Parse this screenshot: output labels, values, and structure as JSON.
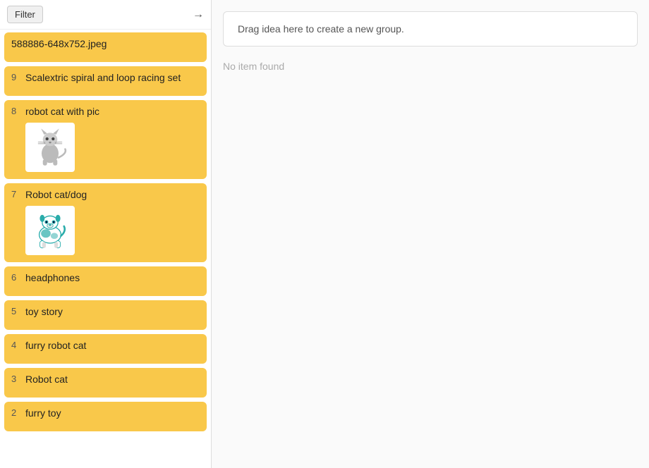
{
  "header": {
    "filter_label": "Filter",
    "arrow_icon": "→"
  },
  "drop_zone": {
    "text": "Drag idea here to create a new group."
  },
  "no_item_text": "No item found",
  "items": [
    {
      "id": "item-file",
      "number": "",
      "title": "588886-648x752.jpeg",
      "has_image": false,
      "image_type": null
    },
    {
      "id": "item-9",
      "number": "9",
      "title": "Scalextric spiral and loop racing set",
      "has_image": false,
      "image_type": null
    },
    {
      "id": "item-8",
      "number": "8",
      "title": "robot cat with pic",
      "has_image": true,
      "image_type": "robot-cat"
    },
    {
      "id": "item-7",
      "number": "7",
      "title": "Robot cat/dog",
      "has_image": true,
      "image_type": "robot-dog"
    },
    {
      "id": "item-6",
      "number": "6",
      "title": "headphones",
      "has_image": false,
      "image_type": null
    },
    {
      "id": "item-5",
      "number": "5",
      "title": "toy story",
      "has_image": false,
      "image_type": null
    },
    {
      "id": "item-4",
      "number": "4",
      "title": "furry robot cat",
      "has_image": false,
      "image_type": null
    },
    {
      "id": "item-3",
      "number": "3",
      "title": "Robot cat",
      "has_image": false,
      "image_type": null
    },
    {
      "id": "item-2",
      "number": "2",
      "title": "furry toy",
      "has_image": false,
      "image_type": null
    }
  ]
}
